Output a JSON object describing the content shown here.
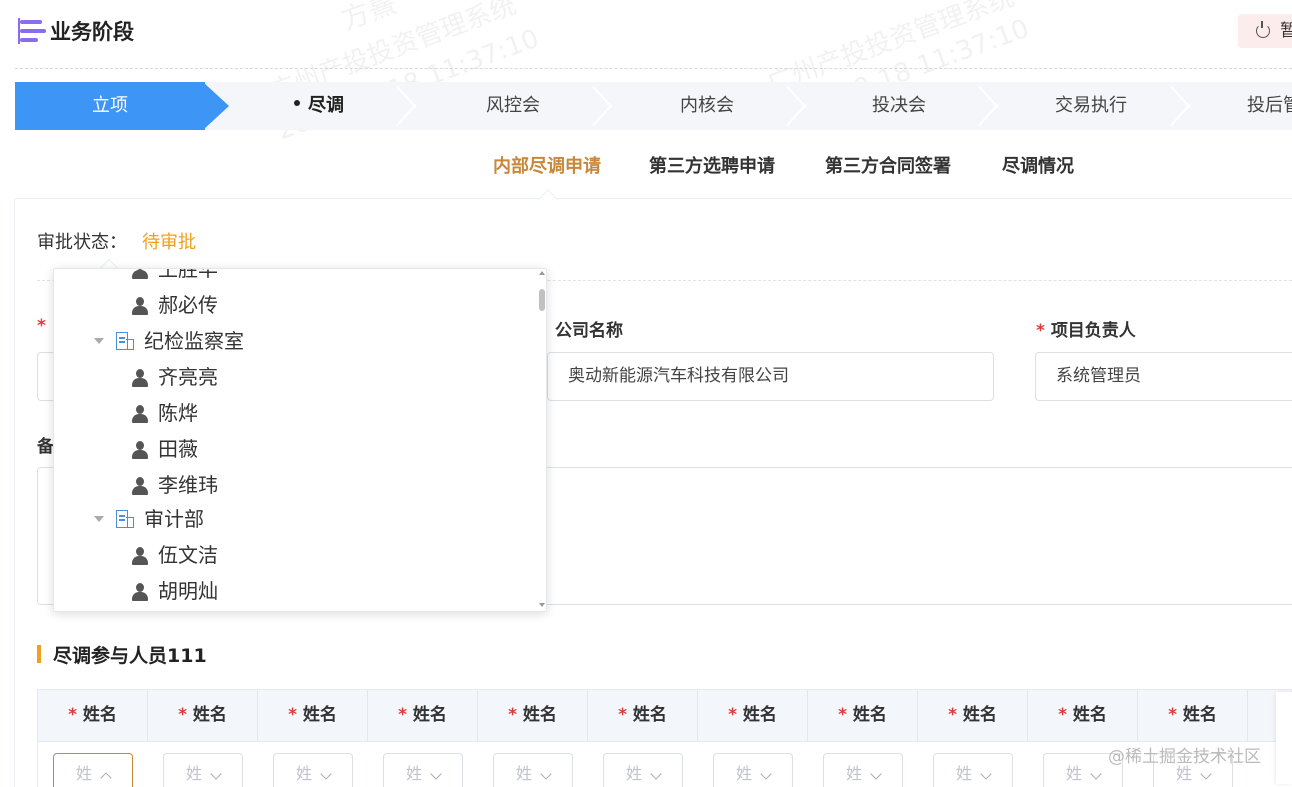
{
  "header": {
    "title": "业务阶段",
    "pause_label": "暂"
  },
  "steps": [
    {
      "label": "立项",
      "state": "done"
    },
    {
      "label": "尽调",
      "state": "current"
    },
    {
      "label": "风控会",
      "state": "todo"
    },
    {
      "label": "内核会",
      "state": "todo"
    },
    {
      "label": "投决会",
      "state": "todo"
    },
    {
      "label": "交易执行",
      "state": "todo"
    },
    {
      "label": "投后管",
      "state": "todo"
    }
  ],
  "subtabs": [
    {
      "label": "内部尽调申请",
      "active": true
    },
    {
      "label": "第三方选聘申请",
      "active": false
    },
    {
      "label": "第三方合同签署",
      "active": false
    },
    {
      "label": "尽调情况",
      "active": false
    }
  ],
  "status": {
    "label": "审批状态：",
    "value": "待审批"
  },
  "form": {
    "first_required_star": "*",
    "company_label": "公司名称",
    "company_value": "奥动新能源汽车科技有限公司",
    "leader_star": "*",
    "leader_label": "项目负责人",
    "leader_value": "系统管理员",
    "remark_label": "备"
  },
  "tree": [
    {
      "type": "person",
      "label": "王胜华",
      "level": 2
    },
    {
      "type": "person",
      "label": "郝必传",
      "level": 2
    },
    {
      "type": "dept",
      "label": "纪检监察室",
      "level": 1
    },
    {
      "type": "person",
      "label": "齐亮亮",
      "level": 2
    },
    {
      "type": "person",
      "label": "陈烨",
      "level": 2
    },
    {
      "type": "person",
      "label": "田薇",
      "level": 2
    },
    {
      "type": "person",
      "label": "李维玮",
      "level": 2
    },
    {
      "type": "dept",
      "label": "审计部",
      "level": 1
    },
    {
      "type": "person",
      "label": "伍文洁",
      "level": 2
    },
    {
      "type": "person",
      "label": "胡明灿",
      "level": 2
    }
  ],
  "section": {
    "title": "尽调参与人员111"
  },
  "table": {
    "required_star": "*",
    "headers": [
      "姓名",
      "姓名",
      "姓名",
      "姓名",
      "姓名",
      "姓名",
      "姓名",
      "姓名",
      "姓名",
      "姓名",
      "姓名"
    ],
    "select_placeholder": "姓"
  },
  "watermark": {
    "line1": "方熹",
    "line2": "广州产投投资管理系统",
    "line3": "2022-10-18 11:37:10"
  },
  "site_mark": "@稀土掘金技术社区",
  "colors": {
    "accent": "#c8883a",
    "step_active": "#3d95f5",
    "pending": "#f0a020",
    "required": "#e03b3b"
  }
}
